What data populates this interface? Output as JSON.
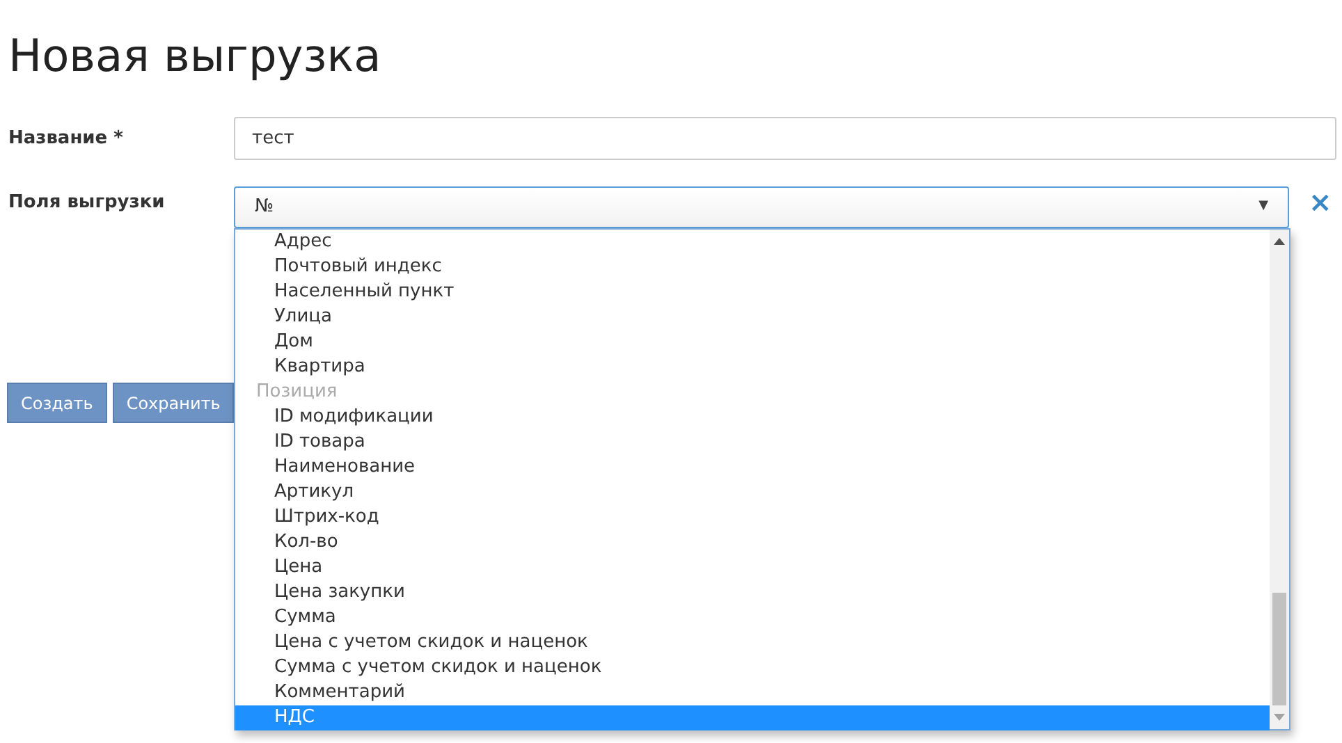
{
  "title": "Новая выгрузка",
  "name_field": {
    "label": "Название *",
    "value": "тест"
  },
  "fields_select": {
    "label": "Поля выгрузки",
    "value": "№",
    "expanded": true,
    "clear": "×",
    "caret": "▼",
    "options": [
      {
        "kind": "option",
        "label": "Адрес",
        "selected": false
      },
      {
        "kind": "option",
        "label": "Почтовый индекс",
        "selected": false
      },
      {
        "kind": "option",
        "label": "Населенный пункт",
        "selected": false
      },
      {
        "kind": "option",
        "label": "Улица",
        "selected": false
      },
      {
        "kind": "option",
        "label": "Дом",
        "selected": false
      },
      {
        "kind": "option",
        "label": "Квартира",
        "selected": false
      },
      {
        "kind": "group",
        "label": "Позиция"
      },
      {
        "kind": "option",
        "label": "ID модификации",
        "selected": false
      },
      {
        "kind": "option",
        "label": "ID товара",
        "selected": false
      },
      {
        "kind": "option",
        "label": "Наименование",
        "selected": false
      },
      {
        "kind": "option",
        "label": "Артикул",
        "selected": false
      },
      {
        "kind": "option",
        "label": "Штрих-код",
        "selected": false
      },
      {
        "kind": "option",
        "label": "Кол-во",
        "selected": false
      },
      {
        "kind": "option",
        "label": "Цена",
        "selected": false
      },
      {
        "kind": "option",
        "label": "Цена закупки",
        "selected": false
      },
      {
        "kind": "option",
        "label": "Сумма",
        "selected": false
      },
      {
        "kind": "option",
        "label": "Цена с учетом скидок и наценок",
        "selected": false
      },
      {
        "kind": "option",
        "label": "Сумма с учетом скидок и наценок",
        "selected": false
      },
      {
        "kind": "option",
        "label": "Комментарий",
        "selected": false
      },
      {
        "kind": "option",
        "label": "НДС",
        "selected": true
      }
    ]
  },
  "buttons": [
    "Создать",
    "Сохранить"
  ]
}
